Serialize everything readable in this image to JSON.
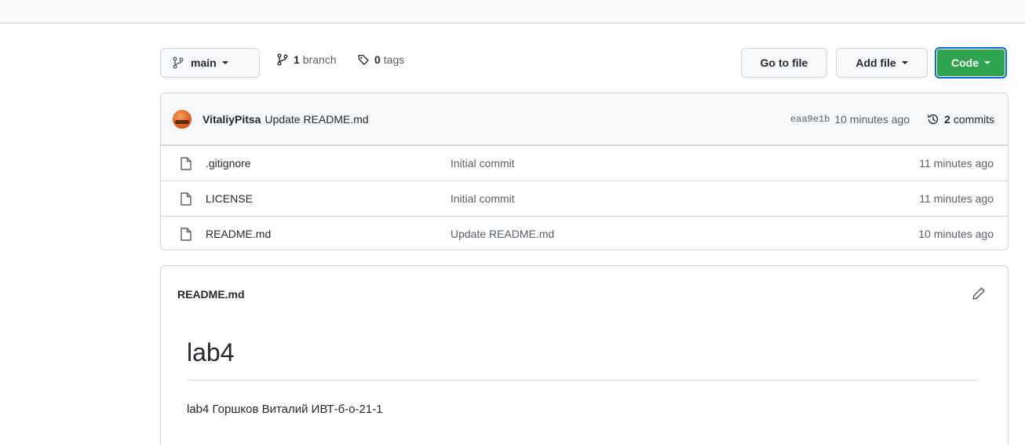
{
  "toolbar": {
    "branch_label": "main",
    "branches_count": "1",
    "branches_label": "branch",
    "tags_count": "0",
    "tags_label": "tags",
    "goto_label": "Go to file",
    "addfile_label": "Add file",
    "code_label": "Code"
  },
  "latest_commit": {
    "author": "VitaliyPitsa",
    "message": "Update README.md",
    "sha": "eaa9e1b",
    "time": "10 minutes ago",
    "commits_count": "2",
    "commits_label": "commits"
  },
  "files": [
    {
      "name": ".gitignore",
      "commit": "Initial commit",
      "age": "11 minutes ago"
    },
    {
      "name": "LICENSE",
      "commit": "Initial commit",
      "age": "11 minutes ago"
    },
    {
      "name": "README.md",
      "commit": "Update README.md",
      "age": "10 minutes ago"
    }
  ],
  "readme": {
    "title": "README.md",
    "heading": "lab4",
    "body": "lab4 Горшков Виталий ИВТ-б-о-21-1"
  },
  "colors": {
    "accent_green": "#2da44e",
    "focus_blue": "#0969da",
    "border": "#d0d7de"
  },
  "icons": [
    "git-branch-icon",
    "tag-icon",
    "history-icon",
    "file-icon",
    "pencil-icon",
    "caret-down-icon"
  ]
}
